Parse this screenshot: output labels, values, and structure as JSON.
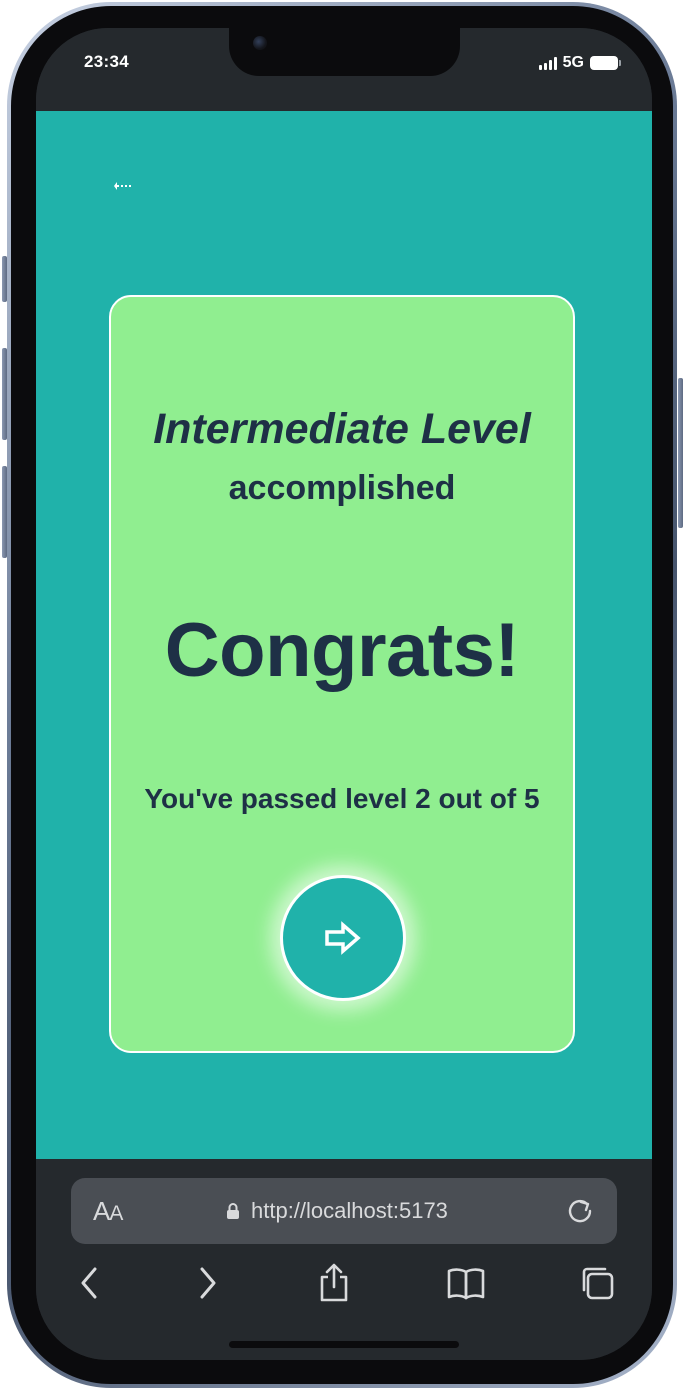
{
  "status_bar": {
    "time": "23:34",
    "network": "5G"
  },
  "screen": {
    "background_color": "#20b2aa",
    "back_icon": "back-arrow-dotted-icon"
  },
  "card": {
    "background_color": "#90ee90",
    "level_title": "Intermediate Level",
    "level_subtitle": "accomplished",
    "headline": "Congrats!",
    "progress_text": "You've passed level 2 out of 5",
    "next_icon": "arrow-right-outline-icon"
  },
  "browser": {
    "text_size_label_big": "A",
    "text_size_label_small": "A",
    "url": "http://localhost:5173",
    "lock_icon": "lock-icon",
    "reload_icon": "reload-icon",
    "toolbar": [
      "back-chevron-icon",
      "forward-chevron-icon",
      "share-icon",
      "bookmarks-icon",
      "tabs-icon"
    ]
  }
}
